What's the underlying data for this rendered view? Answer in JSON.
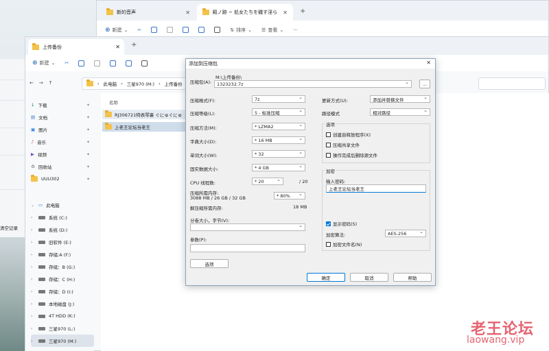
{
  "back_window": {
    "tabs": [
      {
        "label": "新的音声"
      },
      {
        "label": "殿ノ跡 ~ 処女たちを穢す淫ら"
      }
    ],
    "toolbar": {
      "new": "新建",
      "sort": "排序",
      "view": "查看",
      "more": "···"
    }
  },
  "left_window": {
    "text": "清空记录"
  },
  "explorer": {
    "tab": "上传备份",
    "new": "新建",
    "breadcrumb": [
      "此电脑",
      "三星970 (M:)",
      "上传备份"
    ],
    "column_header": "名称",
    "quick_access": [
      {
        "label": "下载",
        "icon": "download-icon"
      },
      {
        "label": "文档",
        "icon": "document-icon"
      },
      {
        "label": "图片",
        "icon": "image-icon"
      },
      {
        "label": "音乐",
        "icon": "music-icon"
      },
      {
        "label": "视频",
        "icon": "video-icon"
      },
      {
        "label": "回收站",
        "icon": "recycle-bin-icon"
      },
      {
        "label": "UUU302",
        "icon": "folder-icon"
      }
    ],
    "this_pc": "此电脑",
    "drives": [
      "系统 (C:)",
      "系统 (D:)",
      "旧软件 (E:)",
      "存储:A (F:)",
      "存储：B (G:)",
      "存储：C (H:)",
      "存储：D (I:)",
      "本地磁盘 (J:)",
      "4T HDD (K:)",
      "三星970 (L:)",
      "三星970 (M:)"
    ],
    "files": [
      "RJ306721特表琴裏 ぐにゅぐにゅ",
      "上老王论坛当老王"
    ]
  },
  "dialog": {
    "title": "添加到压缩包",
    "archive_label": "压缩包(A):",
    "archive_path": "M:\\上传备份\\",
    "archive_name": "1323232.7z",
    "browse": "...",
    "format_label": "压缩格式(F):",
    "format": "7z",
    "level_label": "压缩等级(L):",
    "level": "5 - 标准压缩",
    "method_label": "压缩方法(M):",
    "method": "* LZMA2",
    "dict_label": "字典大小(D):",
    "dict": "* 16 MB",
    "word_label": "单词大小(W):",
    "word": "* 32",
    "solid_label": "固实数据大小:",
    "solid": "* 4 GB",
    "threads_label": "CPU 线程数:",
    "threads": "* 20",
    "threads_total": "/ 20",
    "mem_label": "压缩所需内存:",
    "mem_value": "3088 MB / 26 GB / 32 GB",
    "mem_pct": "* 80%",
    "decomp_label": "解压缩所需内存:",
    "decomp_value": "18 MB",
    "split_label": "分卷大小，字节(V):",
    "split": "",
    "params_label": "参数(P):",
    "params": "",
    "options_btn": "选项",
    "update_label": "更新方式(U):",
    "update": "添加并替换文件",
    "path_label": "路径模式",
    "path": "相对路径",
    "options_group": "选项",
    "opt_sfx": "创建自释放程序(X)",
    "opt_shared": "压缩共享文件",
    "opt_delete": "操作完成后删除源文件",
    "encryption_group": "加密",
    "password_label": "输入密码:",
    "password": "上老王论坛当老王",
    "show_password": "显示密码(S)",
    "enc_method_label": "加密算法:",
    "enc_method": "AES-256",
    "encrypt_names": "加密文件名(N)",
    "ok": "确定",
    "cancel": "取消",
    "help": "帮助"
  },
  "watermark": {
    "line1": "老王论坛",
    "line2": "laowang.vip"
  }
}
